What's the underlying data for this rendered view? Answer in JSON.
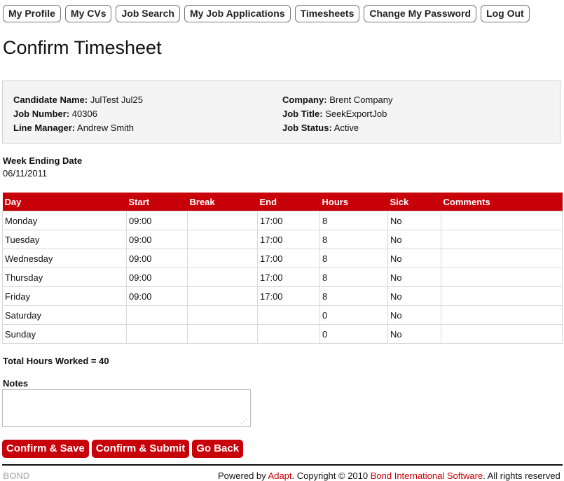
{
  "nav": {
    "items": [
      "My Profile",
      "My CVs",
      "Job Search",
      "My Job Applications",
      "Timesheets",
      "Change My Password",
      "Log Out"
    ]
  },
  "page_title": "Confirm Timesheet",
  "info": {
    "candidate_label": "Candidate Name:",
    "candidate_value": "JulTest Jul25",
    "job_number_label": "Job Number:",
    "job_number_value": "40306",
    "line_manager_label": "Line Manager:",
    "line_manager_value": "Andrew Smith",
    "company_label": "Company:",
    "company_value": "Brent Company",
    "job_title_label": "Job Title:",
    "job_title_value": "SeekExportJob",
    "job_status_label": "Job Status:",
    "job_status_value": "Active"
  },
  "week_ending": {
    "label": "Week Ending Date",
    "value": "06/11/2011"
  },
  "table": {
    "headers": [
      "Day",
      "Start",
      "Break",
      "End",
      "Hours",
      "Sick",
      "Comments"
    ],
    "rows": [
      [
        "Monday",
        "09:00",
        "",
        "17:00",
        "8",
        "No",
        ""
      ],
      [
        "Tuesday",
        "09:00",
        "",
        "17:00",
        "8",
        "No",
        ""
      ],
      [
        "Wednesday",
        "09:00",
        "",
        "17:00",
        "8",
        "No",
        ""
      ],
      [
        "Thursday",
        "09:00",
        "",
        "17:00",
        "8",
        "No",
        ""
      ],
      [
        "Friday",
        "09:00",
        "",
        "17:00",
        "8",
        "No",
        ""
      ],
      [
        "Saturday",
        "",
        "",
        "",
        "0",
        "No",
        ""
      ],
      [
        "Sunday",
        "",
        "",
        "",
        "0",
        "No",
        ""
      ]
    ]
  },
  "total_hours": "Total Hours Worked = 40",
  "notes": {
    "label": "Notes",
    "value": ""
  },
  "actions": {
    "confirm_save": "Confirm & Save",
    "confirm_submit": "Confirm & Submit",
    "go_back": "Go Back"
  },
  "footer": {
    "logo_text": "BOND",
    "powered_by": "Powered by ",
    "adapt_link": "Adapt",
    "copyright": ". Copyright © 2010 ",
    "bond_link": "Bond International Software",
    "rights": ". All rights reserved"
  },
  "colors": {
    "accent": "#c8000a",
    "info_bg": "#f4f4f4"
  }
}
